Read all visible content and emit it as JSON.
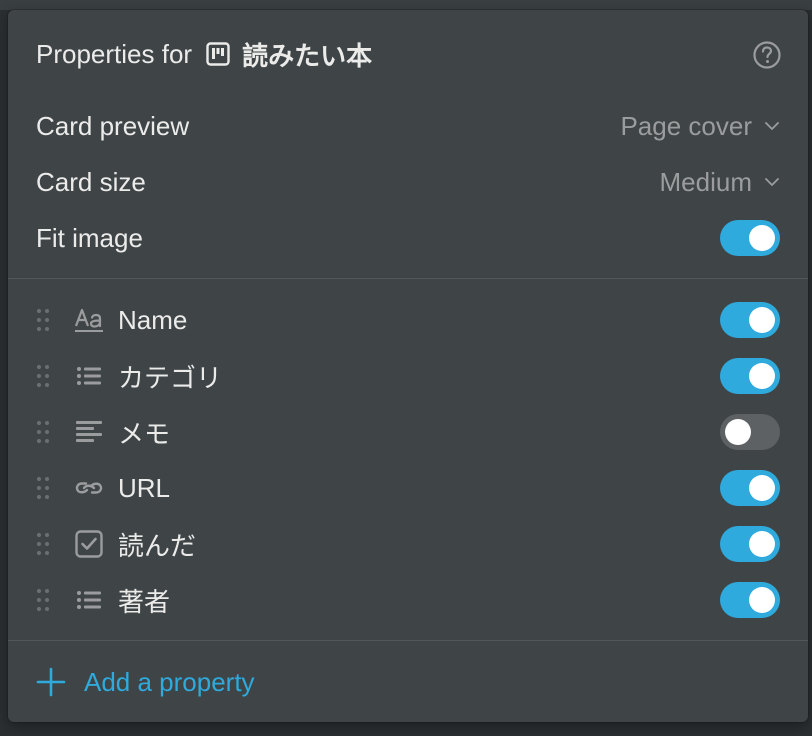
{
  "header": {
    "prefix": "Properties for",
    "database_title": "読みたい本",
    "database_icon": "board-icon",
    "help_icon": "help-circle-icon"
  },
  "settings": {
    "card_preview": {
      "label": "Card preview",
      "value": "Page cover"
    },
    "card_size": {
      "label": "Card size",
      "value": "Medium"
    },
    "fit_image": {
      "label": "Fit image",
      "enabled": true
    }
  },
  "properties": [
    {
      "label": "Name",
      "icon": "title-aa-icon",
      "visible": true
    },
    {
      "label": "カテゴリ",
      "icon": "multi-select-list-icon",
      "visible": true
    },
    {
      "label": "メモ",
      "icon": "text-lines-icon",
      "visible": false
    },
    {
      "label": "URL",
      "icon": "link-icon",
      "visible": true
    },
    {
      "label": "読んだ",
      "icon": "checkbox-icon",
      "visible": true
    },
    {
      "label": "著者",
      "icon": "multi-select-list-icon",
      "visible": true
    }
  ],
  "footer": {
    "add_property_label": "Add a property"
  },
  "colors": {
    "panel_bg": "#3f4447",
    "text": "#ebebea",
    "muted": "#9b9c9d",
    "accent": "#2eaadc",
    "toggle_off": "#5d6164"
  }
}
